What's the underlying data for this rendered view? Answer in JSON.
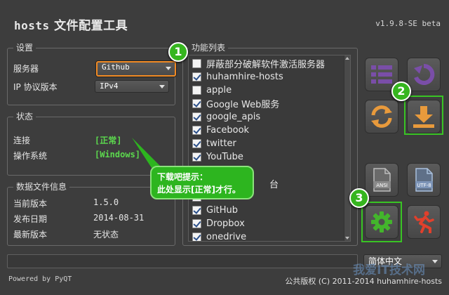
{
  "app": {
    "title_main": "hosts",
    "title_cn": "文件配置工具",
    "version": "v1.9.8-SE beta"
  },
  "settings": {
    "group_title": "设置",
    "server_label": "服务器",
    "server_value": "Github",
    "ip_label": "IP 协议版本",
    "ip_value": "IPv4"
  },
  "status": {
    "group_title": "状态",
    "connect_label": "连接",
    "connect_value": "[正常]",
    "os_label": "操作系统",
    "os_value": "[Windows]"
  },
  "datainfo": {
    "group_title": "数据文件信息",
    "rows": [
      {
        "label": "当前版本",
        "value": "1.5.0"
      },
      {
        "label": "发布日期",
        "value": "2014-08-31"
      },
      {
        "label": "最新版本",
        "value": "无状态"
      }
    ]
  },
  "functions": {
    "group_title": "功能列表",
    "items": [
      {
        "label": "屏蔽部分破解软件激活服务器",
        "checked": false
      },
      {
        "label": "huhamhire-hosts",
        "checked": true
      },
      {
        "label": "apple",
        "checked": false
      },
      {
        "label": "Google Web服务",
        "checked": true
      },
      {
        "label": "google_apis",
        "checked": true
      },
      {
        "label": "Facebook",
        "checked": true
      },
      {
        "label": "twitter",
        "checked": true
      },
      {
        "label": "YouTube",
        "checked": true
      },
      {
        "label": "",
        "checked": true
      },
      {
        "label": "台",
        "checked": true
      },
      {
        "label": "",
        "checked": false
      },
      {
        "label": "GitHub",
        "checked": true
      },
      {
        "label": "Dropbox",
        "checked": true
      },
      {
        "label": "onedrive",
        "checked": true
      }
    ]
  },
  "callout": {
    "line1": "下载吧提示：",
    "line2": "此处显示[正常]才行。"
  },
  "badges": {
    "b1": "1",
    "b2": "2",
    "b3": "3"
  },
  "toolbar": {
    "ansi_label": "ANSI",
    "utf8_label": "UTF-8"
  },
  "footer": {
    "language": "简体中文",
    "powered": "Powered by PyQT",
    "copyright": "公共版权 (C) 2011-2014 huhamhire-hosts",
    "watermark": "我爱IT技术网"
  },
  "colors": {
    "accent_green": "#39c424",
    "status_green": "#5cd94e",
    "highlight_orange": "#f08a24",
    "purple": "#7a4ea8",
    "download_orange": "#e89a3c",
    "gear_green": "#43b52c",
    "exit_red": "#e0402c"
  }
}
